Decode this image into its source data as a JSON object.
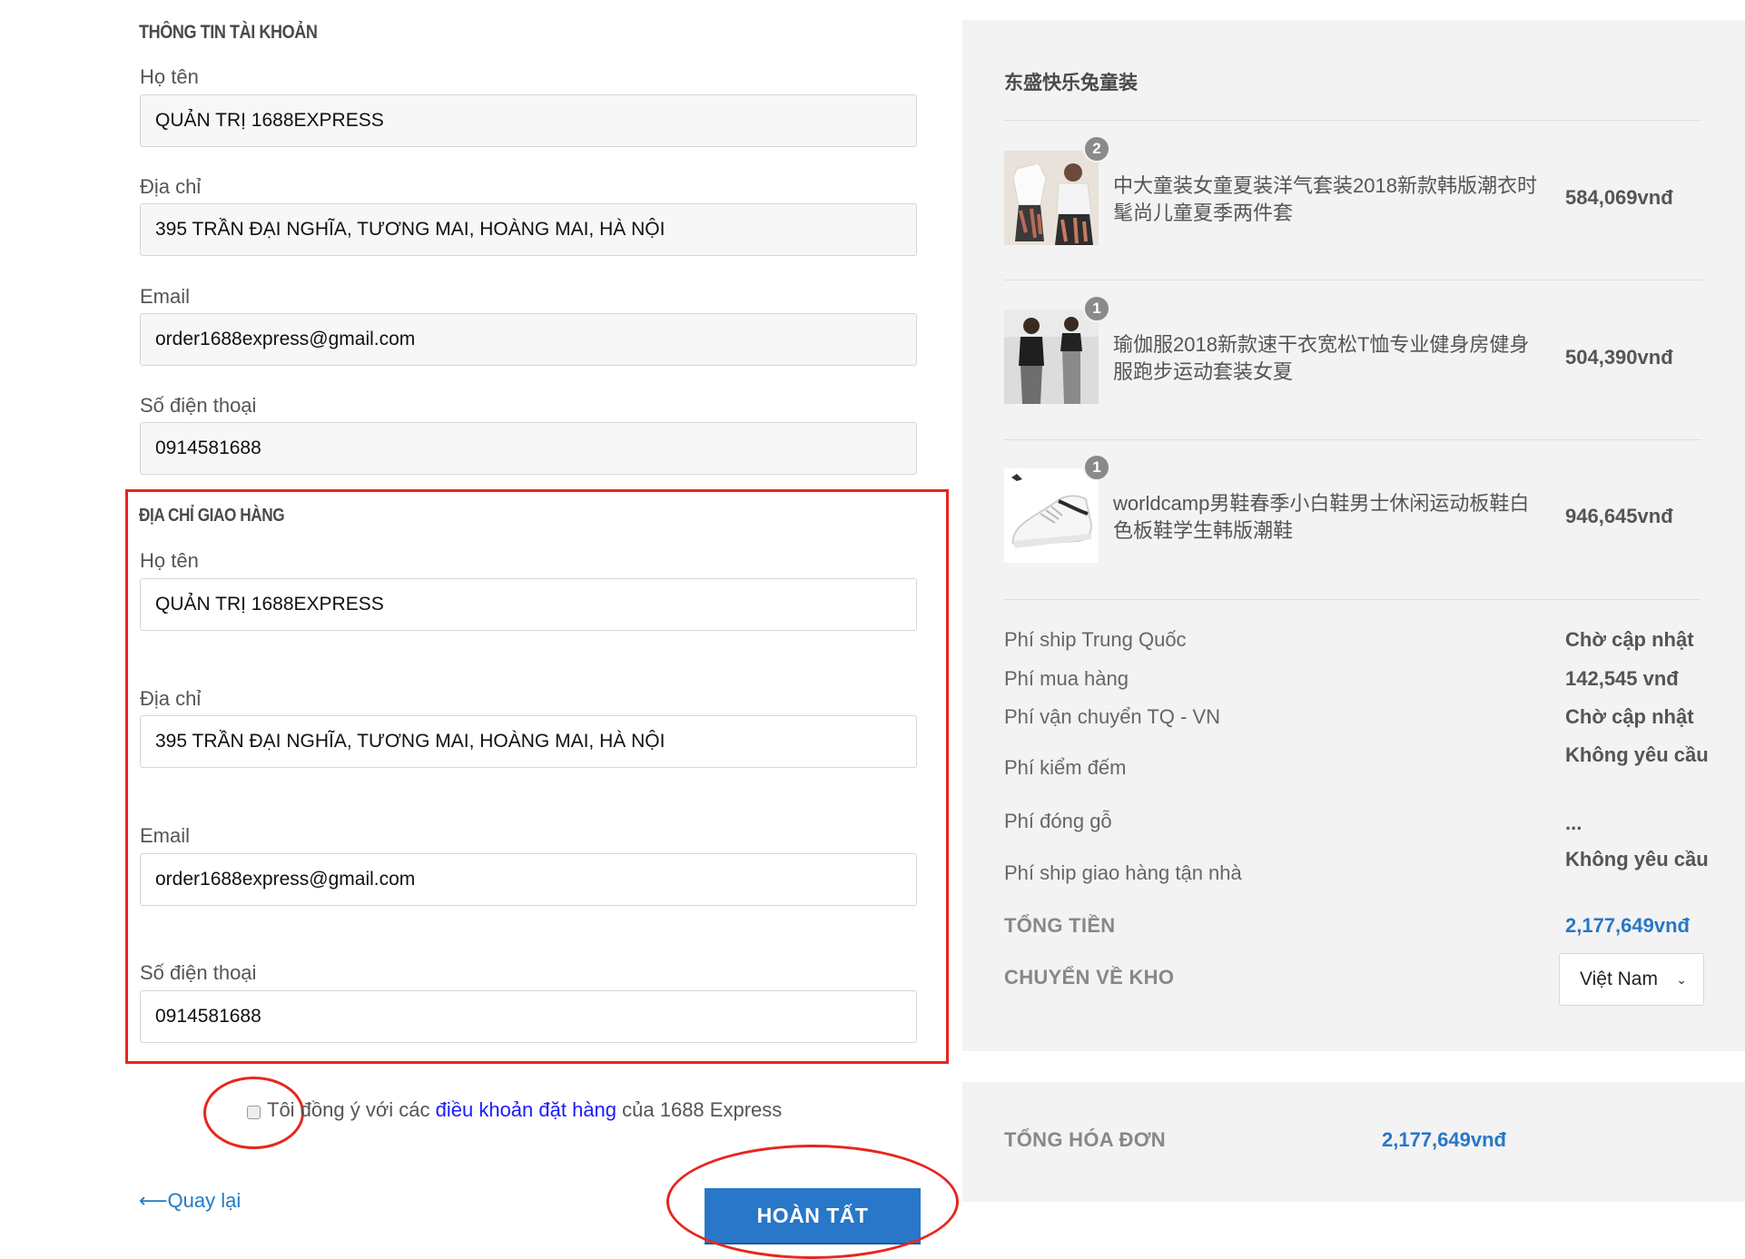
{
  "account_info": {
    "title": "THÔNG TIN TÀI KHOẢN",
    "name_label": "Họ tên",
    "name_value": "QUẢN TRỊ 1688EXPRESS",
    "address_label": "Địa chỉ",
    "address_value": "395 TRẦN ĐẠI NGHĨA, TƯƠNG MAI, HOÀNG MAI, HÀ NỘI",
    "email_label": "Email",
    "email_value": "order1688express@gmail.com",
    "phone_label": "Số điện thoại",
    "phone_value": "0914581688"
  },
  "shipping_address": {
    "title": "ĐỊA CHỈ GIAO HÀNG",
    "name_label": "Họ tên",
    "name_value": "QUẢN TRỊ 1688EXPRESS",
    "address_label": "Địa chỉ",
    "address_value": "395 TRẦN ĐẠI NGHĨA, TƯƠNG MAI, HOÀNG MAI, HÀ NỘI",
    "email_label": "Email",
    "email_value": "order1688express@gmail.com",
    "phone_label": "Số điện thoại",
    "phone_value": "0914581688"
  },
  "agreement": {
    "checked": false,
    "prefix": "Tôi đồng ý với các ",
    "link_text": "điều khoản đặt hàng",
    "suffix": " của 1688 Express"
  },
  "actions": {
    "back_label": "Quay lại",
    "back_arrow": "⟵",
    "finish_label": "HOÀN TẤT"
  },
  "order_summary": {
    "shop_name": "东盛快乐兔童装",
    "items": [
      {
        "qty": "2",
        "name": "中大童装女童夏装洋气套装2018新款韩版潮衣时髦尚儿童夏季两件套",
        "price": "584,069vnđ",
        "thumb_icon": "clothing-photo-icon"
      },
      {
        "qty": "1",
        "name": "瑜伽服2018新款速干衣宽松T恤专业健身房健身服跑步运动套装女夏",
        "price": "504,390vnđ",
        "thumb_icon": "sportswear-photo-icon"
      },
      {
        "qty": "1",
        "name": "worldcamp男鞋春季小白鞋男士休闲运动板鞋白色板鞋学生韩版潮鞋",
        "price": "946,645vnđ",
        "thumb_icon": "sneaker-photo-icon"
      }
    ],
    "fees": [
      {
        "label": "Phí ship Trung Quốc",
        "value": "Chờ cập nhật"
      },
      {
        "label": "Phí mua hàng",
        "value": "142,545 vnđ"
      },
      {
        "label": "Phí vận chuyển TQ - VN",
        "value": "Chờ cập nhật"
      },
      {
        "label": "Phí kiểm đếm",
        "value": "Không yêu cầu"
      },
      {
        "label": "Phí đóng gỗ",
        "value": "..."
      },
      {
        "label": "Phí ship giao hàng tận nhà",
        "value": "Không yêu cầu"
      }
    ],
    "total_label": "TỔNG TIỀN",
    "total_value": "2,177,649vnđ",
    "warehouse_label": "CHUYỂN VỀ KHO",
    "warehouse_selected": "Việt Nam"
  },
  "invoice": {
    "label": "TỔNG HÓA ĐƠN",
    "value": "2,177,649vnđ"
  },
  "colors": {
    "accent": "#2877c8",
    "annotation_red": "#e8261d",
    "panel_bg": "#f3f3f3",
    "link": "#1a1aff"
  }
}
